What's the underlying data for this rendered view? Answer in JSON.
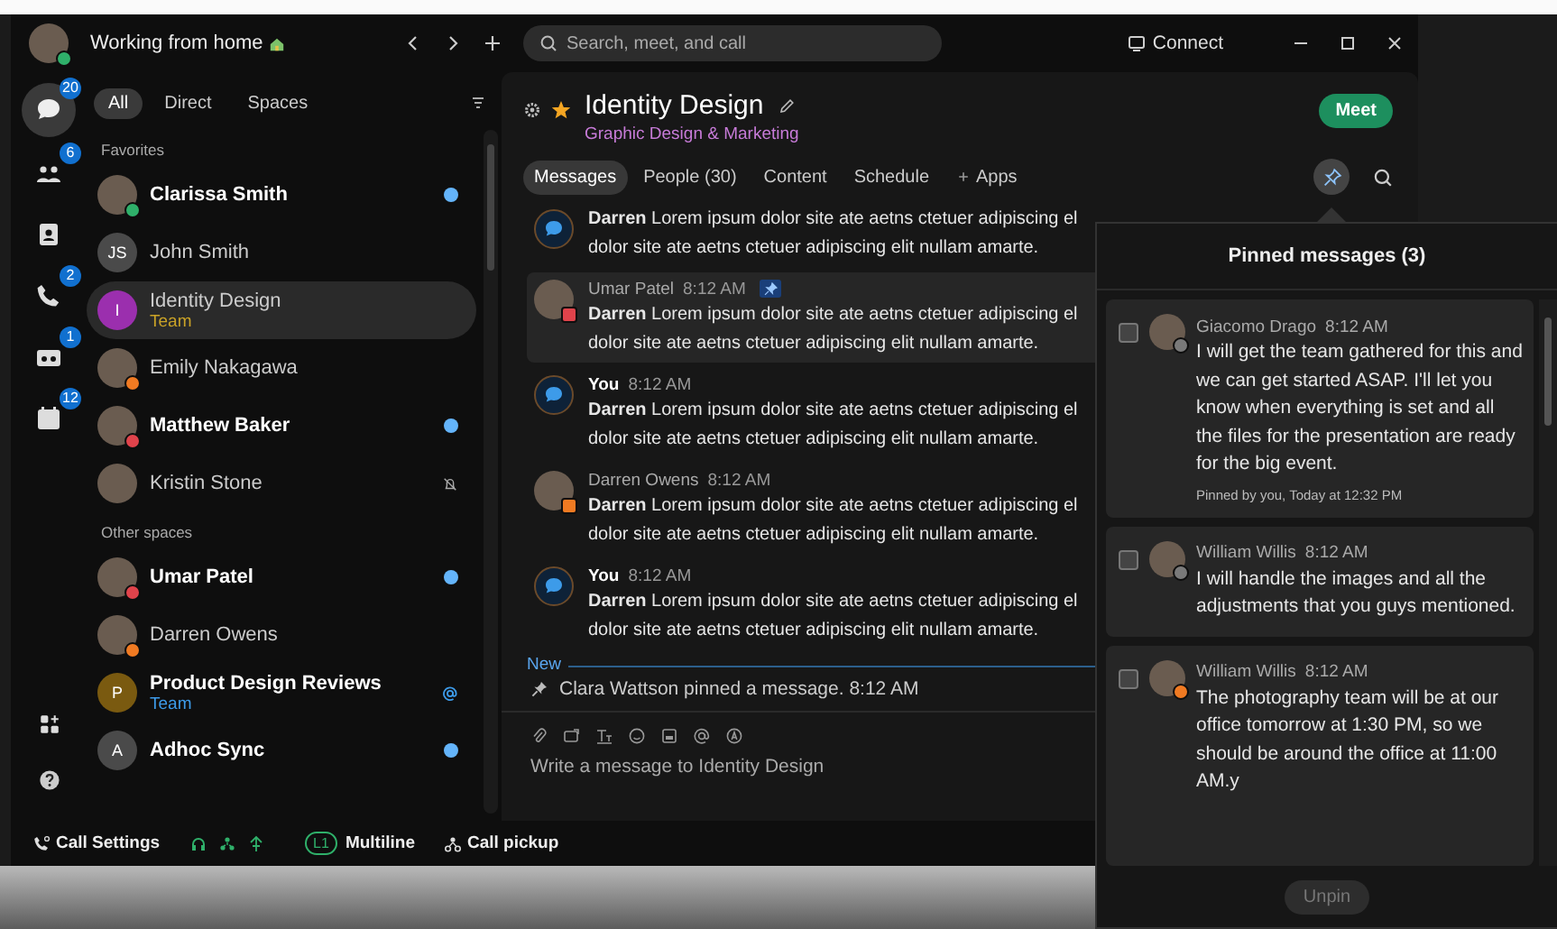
{
  "user": {
    "presence": {
      "color": "#2fb06a"
    },
    "status_text": "Working from home"
  },
  "search": {
    "placeholder": "Search, meet, and call"
  },
  "connect_button": "Connect",
  "rail": [
    {
      "kind": "chat",
      "badge": "20",
      "selected": true
    },
    {
      "kind": "teams",
      "badge": "6",
      "selected": false
    },
    {
      "kind": "contacts",
      "selected": false
    },
    {
      "kind": "phone",
      "badge": "2",
      "selected": false
    },
    {
      "kind": "voicemail",
      "badge": "1",
      "selected": false
    },
    {
      "kind": "calendar",
      "badge": "12",
      "selected": false
    }
  ],
  "rail_bottom": [
    {
      "kind": "apps"
    },
    {
      "kind": "help"
    }
  ],
  "filters": [
    {
      "label": "All",
      "selected": true
    },
    {
      "label": "Direct",
      "selected": false
    },
    {
      "label": "Spaces",
      "selected": false
    }
  ],
  "sections": [
    {
      "title": "Favorites",
      "items": [
        {
          "name": "Clarissa Smith",
          "avatar": {
            "kind": "photo",
            "presence": {
              "color": "#2fb06a"
            }
          },
          "unread": true,
          "selected": false,
          "badge": {
            "kind": "dot"
          }
        },
        {
          "name": "John Smith",
          "avatar": {
            "kind": "initials",
            "text": "JS",
            "color": "#4a4a4a"
          },
          "unread": false,
          "selected": false
        },
        {
          "name": "Identity Design",
          "subtitle": {
            "text": "Team",
            "color": "#c9a227"
          },
          "avatar": {
            "kind": "initials",
            "text": "I",
            "color": "#9b2fae"
          },
          "unread": false,
          "selected": true
        },
        {
          "name": "Emily Nakagawa",
          "avatar": {
            "kind": "photo",
            "presence": {
              "color": "#f07a22"
            }
          },
          "unread": false,
          "selected": false
        },
        {
          "name": "Matthew Baker",
          "avatar": {
            "kind": "photo",
            "presence": {
              "color": "#e0434b"
            }
          },
          "unread": true,
          "selected": false,
          "badge": {
            "kind": "dot"
          }
        },
        {
          "name": "Kristin Stone",
          "avatar": {
            "kind": "photo"
          },
          "unread": false,
          "selected": false,
          "badge": {
            "kind": "muted"
          }
        }
      ]
    },
    {
      "title": "Other spaces",
      "items": [
        {
          "name": "Umar Patel",
          "avatar": {
            "kind": "photo",
            "presence": {
              "color": "#e0434b"
            }
          },
          "unread": true,
          "selected": false,
          "badge": {
            "kind": "dot"
          }
        },
        {
          "name": "Darren Owens",
          "avatar": {
            "kind": "photo",
            "presence": {
              "color": "#f07a22"
            }
          },
          "unread": false,
          "selected": false
        },
        {
          "name": "Product Design Reviews",
          "subtitle": {
            "text": "Team",
            "color": "#3d9be9"
          },
          "avatar": {
            "kind": "initials",
            "text": "P",
            "color": "#7a5a10"
          },
          "unread": true,
          "selected": false,
          "badge": {
            "kind": "mention"
          }
        },
        {
          "name": "Adhoc Sync",
          "avatar": {
            "kind": "initials",
            "text": "A",
            "color": "#4a4a4a"
          },
          "unread": true,
          "selected": false,
          "badge": {
            "kind": "dot"
          }
        }
      ]
    }
  ],
  "call_bar": {
    "settings": "Call Settings",
    "line_badge": "L1",
    "multiline": "Multiline",
    "pickup": "Call pickup"
  },
  "space": {
    "title": "Identity Design",
    "favorite": true,
    "subtitle": "Graphic Design & Marketing",
    "meet_button": "Meet"
  },
  "tabs": [
    {
      "label": "Messages",
      "kind": "tab",
      "selected": true
    },
    {
      "label": "People (30)",
      "kind": "tab",
      "selected": false
    },
    {
      "label": "Content",
      "kind": "tab",
      "selected": false
    },
    {
      "label": "Schedule",
      "kind": "tab",
      "selected": false
    },
    {
      "label": "Apps",
      "kind": "add",
      "selected": false
    }
  ],
  "pin_button": {
    "selected": true
  },
  "messages": [
    {
      "kind": "self",
      "pinned": false,
      "lines": [
        "**Darren** Lorem ipsum dolor site ate aetns ctetuer adipiscing el",
        "dolor site ate aetns ctetuer adipiscing elit nullam amarte."
      ]
    },
    {
      "kind": "person",
      "presence": {
        "color": "#e0434b"
      },
      "sender": "Umar Patel",
      "time": "8:12 AM",
      "pinned": true,
      "lines": [
        "**Darren** Lorem ipsum dolor site ate aetns ctetuer adipiscing el",
        "dolor site ate aetns ctetuer adipiscing elit nullam amarte."
      ]
    },
    {
      "kind": "self",
      "sender": "You",
      "time": "8:12 AM",
      "pinned": false,
      "lines": [
        "**Darren** Lorem ipsum dolor site ate aetns ctetuer adipiscing el",
        "dolor site ate aetns ctetuer adipiscing elit nullam amarte."
      ]
    },
    {
      "kind": "person",
      "presence": {
        "color": "#f07a22"
      },
      "sender": "Darren Owens",
      "time": "8:12 AM",
      "pinned": false,
      "lines": [
        "**Darren** Lorem ipsum dolor site ate aetns ctetuer adipiscing el",
        "dolor site ate aetns ctetuer adipiscing elit nullam amarte."
      ]
    },
    {
      "kind": "self",
      "sender": "You",
      "time": "8:12 AM",
      "pinned": false,
      "lines": [
        "**Darren** Lorem ipsum dolor site ate aetns ctetuer adipiscing el",
        "dolor site ate aetns ctetuer adipiscing elit nullam amarte."
      ]
    }
  ],
  "new_marker": "New",
  "pin_notice": "Clara Wattson pinned a message. 8:12 AM",
  "composer": {
    "placeholder": "Write a message to Identity Design"
  },
  "pinned_panel": {
    "title": "Pinned messages (3)",
    "unpin_button": {
      "label": "Unpin",
      "disabled": true
    },
    "items": [
      {
        "sender": "Giacomo Drago",
        "time": "8:12 AM",
        "presence": {
          "color": "#7a7a7a"
        },
        "checked": false,
        "text": "I will get the team gathered for this and we can get started ASAP. I'll let you know when everything is set and all the files for the presentation are ready for the big event.",
        "footer": "Pinned by you, Today at 12:32 PM"
      },
      {
        "sender": "William Willis",
        "time": "8:12 AM",
        "presence": {
          "color": "#7a7a7a"
        },
        "checked": false,
        "text": "I will handle the images and all the adjustments that you guys mentioned."
      },
      {
        "sender": "William Willis",
        "time": "8:12 AM",
        "presence": {
          "color": "#f07a22"
        },
        "checked": false,
        "text": "The photography team will be at our office tomorrow at 1:30 PM, so we should be around the office at 11:00 AM.y"
      }
    ]
  }
}
